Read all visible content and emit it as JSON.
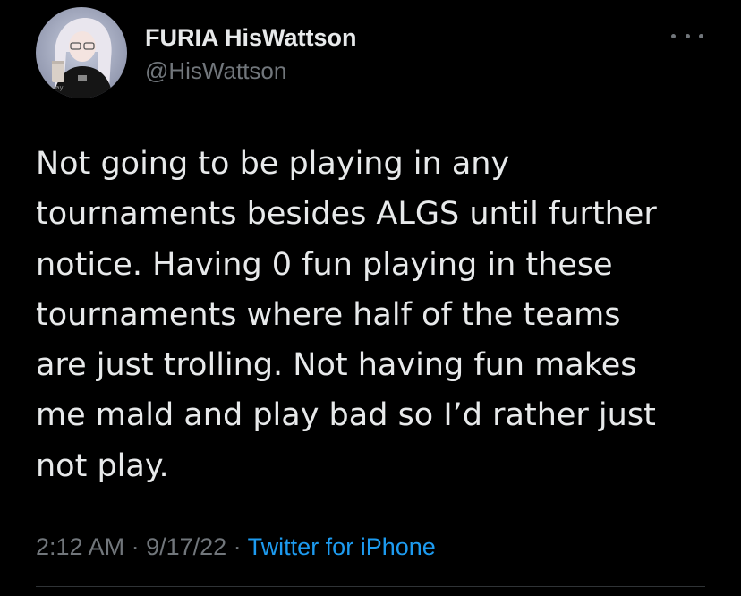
{
  "author": {
    "display_name": "FURIA HisWattson",
    "handle": "@HisWattson",
    "avatar_icon": "profile-avatar"
  },
  "more_icon": "more-horizontal-icon",
  "tweet": {
    "text": "Not going to be playing in any\ntournaments besides ALGS until further\nnotice. Having 0 fun playing in these\ntournaments where half of the teams\nare just trolling. Not having fun makes\nme mald and play bad so I’d rather just\nnot play.",
    "time": "2:12 AM",
    "sep1": " · ",
    "date": "9/17/22",
    "sep2": " · ",
    "source": "Twitter for iPhone"
  },
  "colors": {
    "background": "#000000",
    "primary_text": "#e7e9ea",
    "secondary_text": "#71767b",
    "link": "#1d9bf0",
    "divider": "#2f3336"
  }
}
